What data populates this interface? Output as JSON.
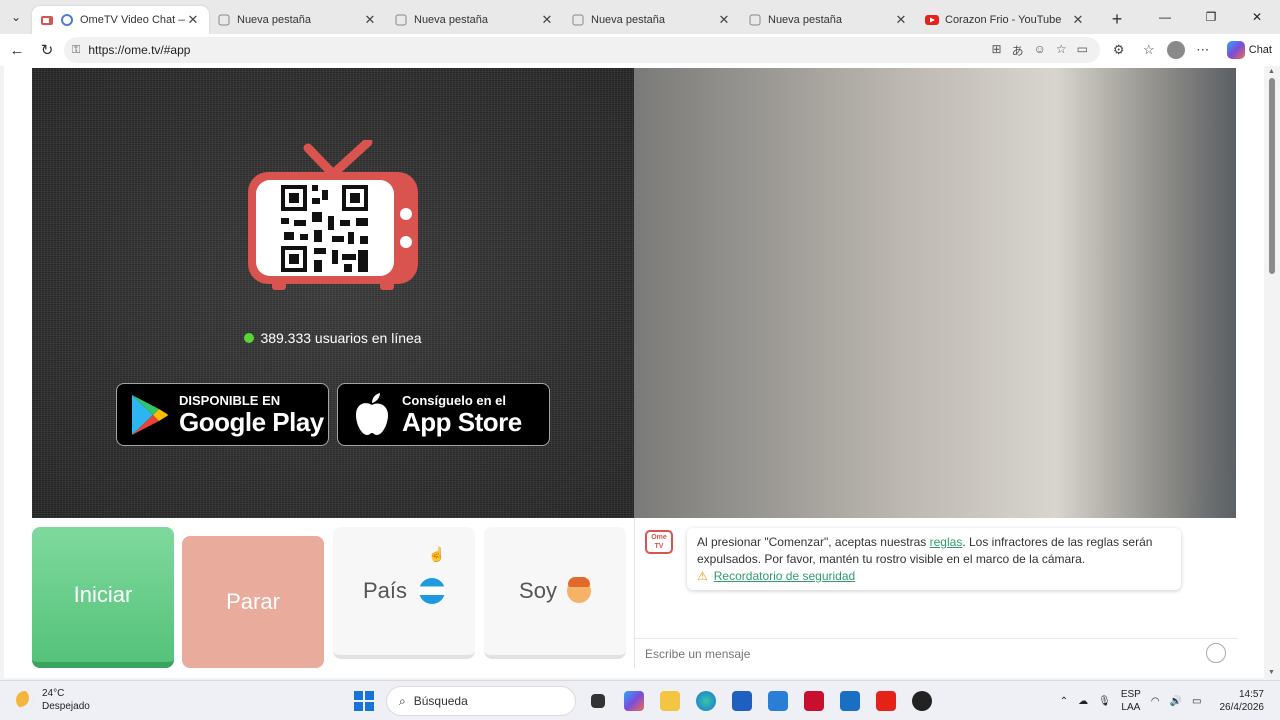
{
  "browser": {
    "tabs": [
      {
        "title": "OmeTV Video Chat — Ome",
        "active": true
      },
      {
        "title": "Nueva pestaña",
        "active": false
      },
      {
        "title": "Nueva pestaña",
        "active": false
      },
      {
        "title": "Nueva pestaña",
        "active": false
      },
      {
        "title": "Nueva pestaña",
        "active": false
      },
      {
        "title": "Corazon Frio - YouTube",
        "active": false
      }
    ],
    "url": "https://ome.tv/#app",
    "chat_label": "Chat"
  },
  "app": {
    "online_text": "389.333 usuarios en línea",
    "google_play": {
      "small": "DISPONIBLE EN",
      "big": "Google Play"
    },
    "app_store": {
      "small": "Consíguelo en el",
      "big": "App Store"
    },
    "buttons": {
      "start": "Iniciar",
      "stop": "Parar",
      "country": "País",
      "gender": "Soy"
    },
    "logo_text_top": "Ome",
    "logo_text_bottom": "TV",
    "notice": {
      "text_before": "Al presionar \"Comenzar\", aceptas nuestras ",
      "rules_link": "reglas",
      "text_after": ". Los infractores de las reglas serán expulsados. Por favor, mantén tu rostro visible en el marco de la cámara.",
      "safety_link": "Recordatorio de seguridad"
    },
    "message_placeholder": "Escribe un mensaje"
  },
  "taskbar": {
    "temperature": "24°C",
    "weather": "Despejado",
    "search": "Búsqueda",
    "lang_top": "ESP",
    "lang_bottom": "LAA",
    "time": "14:57",
    "date": "26/4/2026"
  },
  "colors": {
    "start_green": "#55c27a",
    "stop_salmon": "#e8ab9c",
    "tv_red": "#d9534f",
    "online_dot": "#5ad533"
  }
}
